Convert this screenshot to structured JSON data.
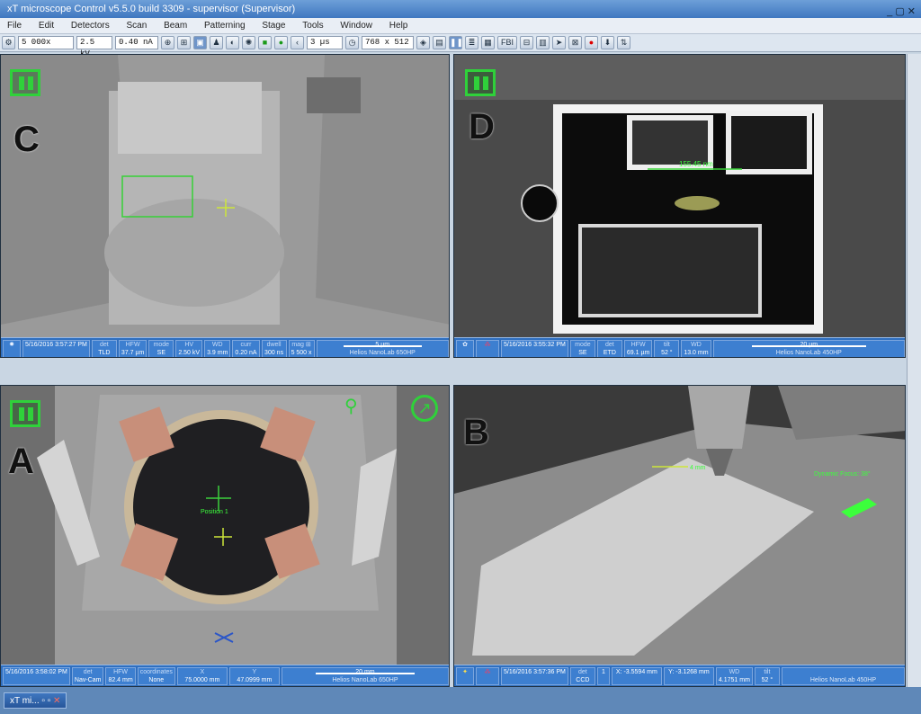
{
  "window": {
    "title": "xT microscope Control v5.5.0 build 3309 - supervisor (Supervisor)",
    "controls": "_ ▢ ✕"
  },
  "menu": [
    "File",
    "Edit",
    "Detectors",
    "Scan",
    "Beam",
    "Patterning",
    "Stage",
    "Tools",
    "Window",
    "Help"
  ],
  "toolbar": {
    "magnification": "5 000x",
    "voltage": "2.5 kV",
    "current": "0.40 nA",
    "dwell": "3 µs",
    "resolution": "768 x 512",
    "fbi_label": "FBI"
  },
  "quadrants": {
    "c": {
      "letter": "C",
      "info": [
        {
          "k": "",
          "v": "5/16/2016 3:57:27 PM"
        },
        {
          "k": "det",
          "v": "TLD"
        },
        {
          "k": "HFW",
          "v": "37.7 µm"
        },
        {
          "k": "mode",
          "v": "SE"
        },
        {
          "k": "HV",
          "v": "2.50 kV"
        },
        {
          "k": "WD",
          "v": "3.9 mm"
        },
        {
          "k": "curr",
          "v": "0.20 nA"
        },
        {
          "k": "dwell",
          "v": "300 ns"
        },
        {
          "k": "mag ⊞",
          "v": "5 500 x"
        }
      ],
      "scale": "5 µm",
      "instrument": "Helios NanoLab 650HP"
    },
    "d": {
      "letter": "D",
      "annotation": "155.45 nm",
      "info": [
        {
          "k": "",
          "v": "5/16/2016 3:55:32 PM"
        },
        {
          "k": "mode",
          "v": "SE"
        },
        {
          "k": "det",
          "v": "ETD"
        },
        {
          "k": "HFW",
          "v": "69.1 µm"
        },
        {
          "k": "tilt",
          "v": "52 °"
        },
        {
          "k": "WD",
          "v": "13.0 mm"
        }
      ],
      "scale": "20 µm",
      "instrument": "Helios NanoLab 450HP"
    },
    "a": {
      "letter": "A",
      "annotation": "Position 1",
      "info": [
        {
          "k": "",
          "v": "5/16/2016 3:58:02 PM"
        },
        {
          "k": "det",
          "v": "Nav-Cam"
        },
        {
          "k": "HFW",
          "v": "82.4 mm"
        },
        {
          "k": "coordinates",
          "v": "None"
        },
        {
          "k": "X",
          "v": "75.0000 mm"
        },
        {
          "k": "Y",
          "v": "47.0999 mm"
        }
      ],
      "scale": "20 mm",
      "instrument": "Helios NanoLab 650HP"
    },
    "b": {
      "letter": "B",
      "annotation": "4 mm",
      "focus_text": "Dynamic Focus: 38°",
      "info": [
        {
          "k": "",
          "v": "5/16/2016 3:57:36 PM"
        },
        {
          "k": "det",
          "v": "CCD"
        },
        {
          "k": "",
          "v": "1"
        },
        {
          "k": "",
          "v": "X: -3.5594 mm"
        },
        {
          "k": "",
          "v": "Y: -3.1268 mm"
        },
        {
          "k": "WD",
          "v": "4.1751 mm"
        },
        {
          "k": "tilt",
          "v": "52 °"
        }
      ],
      "scale": "",
      "instrument": "Helios NanoLab 450HP"
    }
  },
  "taskbar": {
    "label": "xT mi..."
  }
}
